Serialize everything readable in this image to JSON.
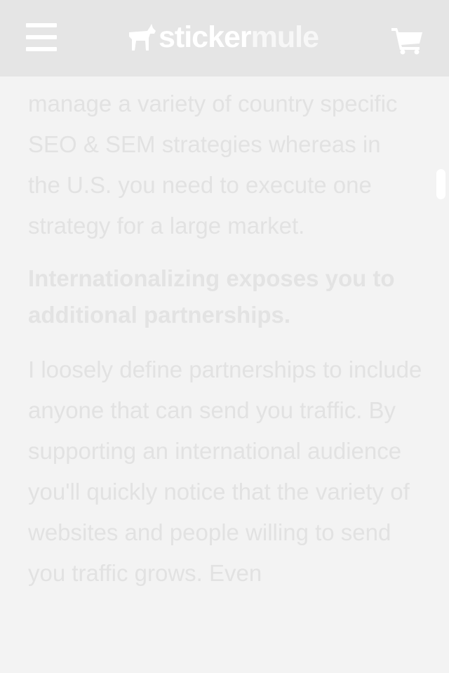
{
  "header": {
    "logo_part1": "sticker",
    "logo_part2": "mule"
  },
  "article": {
    "paragraph_top": "manage a variety of country specific SEO & SEM strategies whereas in the U.S. you need to execute one strategy for a large market.",
    "heading": "Internationalizing exposes you to additional partnerships.",
    "paragraph_bottom": "I loosely define partnerships to include anyone that can send you traffic. By supporting an international audience you'll quickly notice that the variety of websites and people willing to send you traffic grows. Even"
  },
  "icons": {
    "menu": "hamburger-menu-icon",
    "logo": "mule-logo-icon",
    "cart": "shopping-cart-icon"
  },
  "colors": {
    "header_bg": "#e5e5e5",
    "page_bg": "#f3f3f3",
    "text": "#e2e2e2",
    "icon": "#ffffff"
  }
}
